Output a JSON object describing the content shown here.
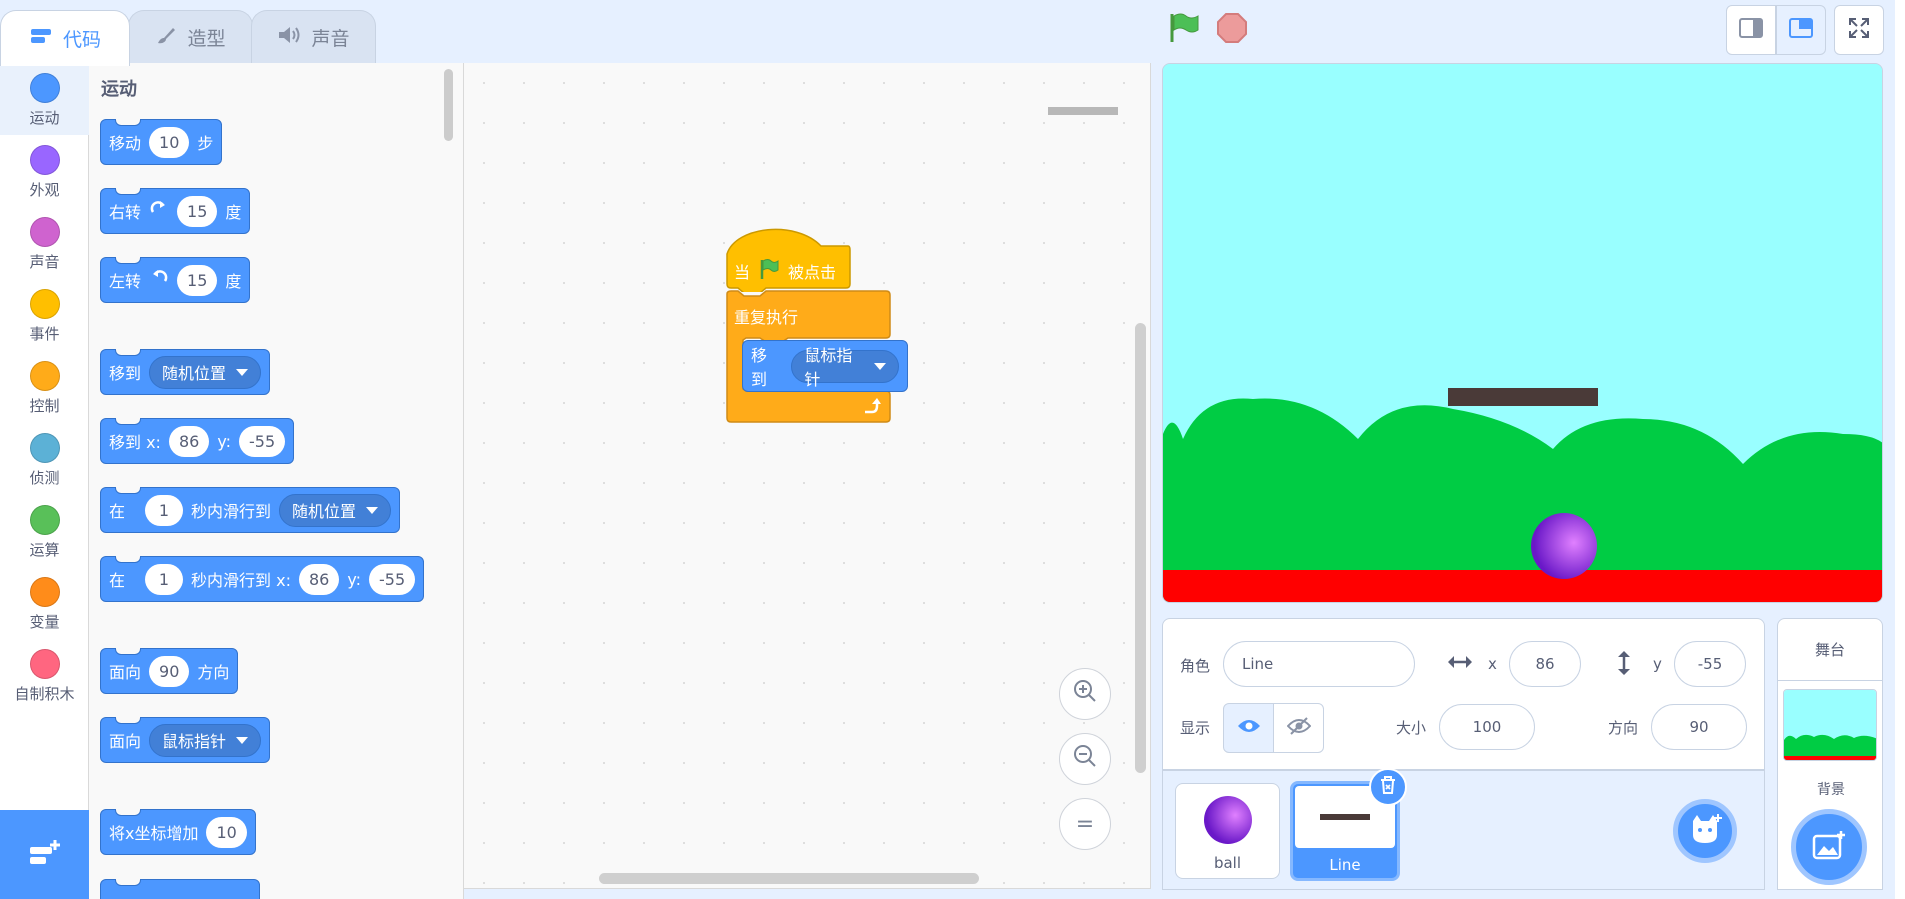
{
  "tabs": [
    {
      "label": "代码",
      "icon": "code-icon"
    },
    {
      "label": "造型",
      "icon": "brush-icon"
    },
    {
      "label": "声音",
      "icon": "speaker-icon"
    }
  ],
  "categories": [
    {
      "label": "运动",
      "color": "#4c97ff"
    },
    {
      "label": "外观",
      "color": "#9966ff"
    },
    {
      "label": "声音",
      "color": "#cf63cf"
    },
    {
      "label": "事件",
      "color": "#ffbf00"
    },
    {
      "label": "控制",
      "color": "#ffab19"
    },
    {
      "label": "侦测",
      "color": "#5cb1d6"
    },
    {
      "label": "运算",
      "color": "#59c059"
    },
    {
      "label": "变量",
      "color": "#ff8c1a"
    },
    {
      "label": "自制积木",
      "color": "#ff6680"
    }
  ],
  "palette": {
    "section_title": "运动",
    "move": {
      "label": "移动",
      "value": "10",
      "unit": "步"
    },
    "turn_right": {
      "label": "右转",
      "value": "15",
      "unit": "度"
    },
    "turn_left": {
      "label": "左转",
      "value": "15",
      "unit": "度"
    },
    "goto": {
      "label": "移到",
      "option": "随机位置"
    },
    "goto_xy": {
      "label": "移到 x:",
      "x": "86",
      "ylabel": "y:",
      "y": "-55"
    },
    "glide": {
      "label": "在",
      "secs": "1",
      "mid": "秒内滑行到",
      "option": "随机位置"
    },
    "glide_xy": {
      "label": "在",
      "secs": "1",
      "mid": "秒内滑行到 x:",
      "x": "86",
      "ylabel": "y:",
      "y": "-55"
    },
    "point_dir": {
      "label": "面向",
      "value": "90",
      "unit": "方向"
    },
    "point_towards": {
      "label": "面向",
      "option": "鼠标指针"
    },
    "change_x": {
      "label": "将x坐标增加",
      "value": "10"
    }
  },
  "script": {
    "hat_prefix": "当",
    "hat_suffix": "被点击",
    "forever": "重复执行",
    "goto_label": "移到",
    "goto_option": "鼠标指针"
  },
  "zoom_controls": {
    "reset": "="
  },
  "sprite_info": {
    "sprite_label": "角色",
    "sprite_name": "Line",
    "x_label": "x",
    "x": "86",
    "y_label": "y",
    "y": "-55",
    "show_label": "显示",
    "size_label": "大小",
    "size": "100",
    "direction_label": "方向",
    "direction": "90"
  },
  "sprites": [
    {
      "name": "ball"
    },
    {
      "name": "Line"
    }
  ],
  "stage_pane": {
    "title": "舞台",
    "backdrop_label": "背景"
  }
}
